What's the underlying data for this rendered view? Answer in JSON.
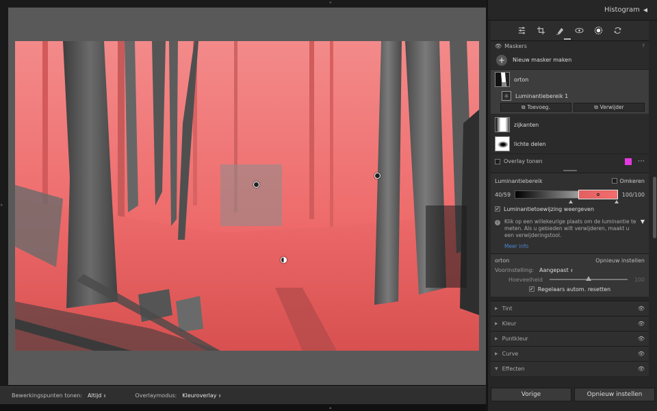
{
  "bottom_bar": {
    "edit_points_label": "Bewerkingspunten tonen:",
    "edit_points_value": "Altijd",
    "overlay_mode_label": "Overlaymodus:",
    "overlay_mode_value": "Kleuroverlay"
  },
  "panel": {
    "histogram_label": "Histogram",
    "tools": [
      {
        "name": "edit-sliders-icon"
      },
      {
        "name": "crop-icon"
      },
      {
        "name": "healing-icon"
      },
      {
        "name": "red-eye-icon"
      },
      {
        "name": "masking-icon"
      },
      {
        "name": "presets-icon"
      }
    ],
    "masks": {
      "title": "Maskers",
      "new_mask": "Nieuw masker maken",
      "items": [
        {
          "label": "orton"
        },
        {
          "label": "zijkanten"
        },
        {
          "label": "lichte delen"
        }
      ],
      "sub_mask": "Luminantiebereik 1",
      "add_label": "Toevoeg.",
      "remove_label": "Verwijder",
      "overlay_label": "Overlay tonen",
      "overlay_color": "#e33ae0"
    },
    "luminance": {
      "title": "Luminantiebereik",
      "invert_label": "Omkeren",
      "range_left": "40/59",
      "range_right": "100/100",
      "range_low": 40,
      "range_high": 100,
      "show_map_label": "Luminantietoewijzing weergeven",
      "info_text": "Klik op een willekeurige plaats om de luminantie te meten. Als u gebieden wilt verwijderen, maakt u een verwijderingstool.",
      "more_info": "Meer info"
    },
    "preset": {
      "name": "orton",
      "reset_label": "Opnieuw instellen",
      "preset_label": "Voorinstelling:",
      "preset_value": "Aangepast",
      "amount_label": "Hoeveelheid",
      "amount_value": "100",
      "auto_reset_label": "Regelaars autom. resetten"
    },
    "sections": [
      {
        "label": "Tint"
      },
      {
        "label": "Kleur"
      },
      {
        "label": "Puntkleur"
      },
      {
        "label": "Curve"
      },
      {
        "label": "Effecten"
      }
    ],
    "footer": {
      "previous": "Vorige",
      "reset": "Opnieuw instellen"
    }
  }
}
